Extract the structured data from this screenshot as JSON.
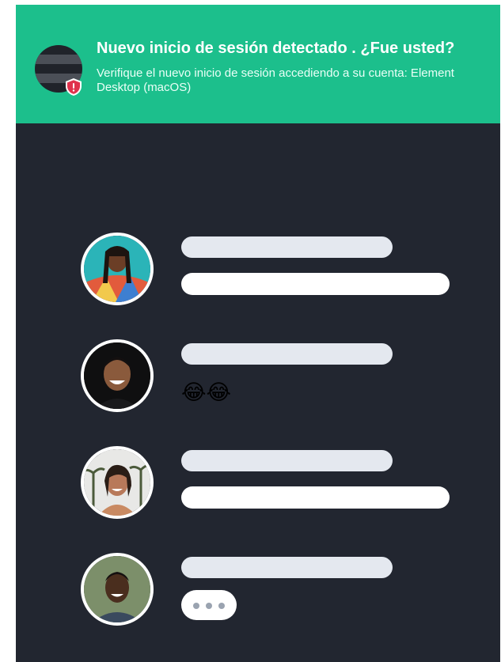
{
  "banner": {
    "title": "Nuevo inicio de sesión detectado . ¿Fue usted?",
    "message": "Verifique el nuevo inicio de sesión accediendo a su cuenta: Element Desktop (macOS)",
    "accent_color": "#1cbf8c",
    "icons": [
      "device-icon",
      "shield-warning-icon"
    ]
  },
  "background_color": "#222630",
  "chat": {
    "messages": [
      {
        "avatar": "woman-braids-avatar",
        "content": "placeholder-lines"
      },
      {
        "avatar": "laughing-man-avatar",
        "content": "😂😂"
      },
      {
        "avatar": "smiling-woman-palms-avatar",
        "content": "placeholder-lines"
      },
      {
        "avatar": "smiling-man-avatar",
        "content": "typing-indicator"
      }
    ]
  }
}
